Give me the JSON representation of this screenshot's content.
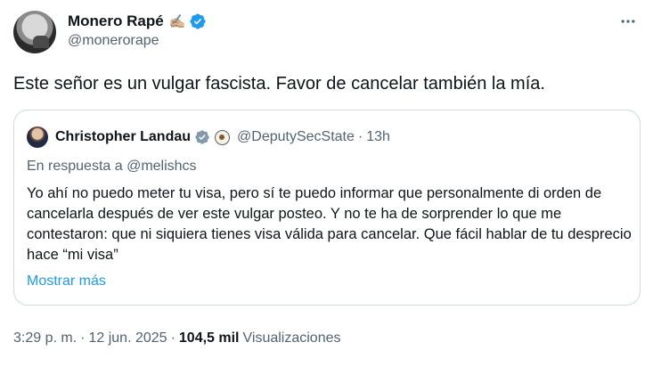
{
  "author": {
    "display_name": "Monero Rapé",
    "pen_emoji": "✍🏼",
    "handle": "@monerorape",
    "verified_color": "#1d9bf0"
  },
  "tweet": {
    "text": "Este señor es un vulgar fascista. Favor de cancelar también la mía."
  },
  "quote": {
    "display_name": "Christopher Landau",
    "handle": "@DeputySecState",
    "dot": "·",
    "time": "13h",
    "reply_to": "En respuesta a @melishcs",
    "text": "Yo ahí no puedo meter tu visa, pero sí te puedo informar que personalmente di orden de cancelarla después de ver este vulgar posteo. Y no te ha de sorprender lo que me contestaron: que ni siquiera tienes visa válida para cancelar. Que fácil hablar de tu desprecio hace “mi visa”",
    "show_more": "Mostrar más",
    "badge_color": "#829aab"
  },
  "meta": {
    "time": "3:29 p. m.",
    "sep": "·",
    "date": "12 jun. 2025",
    "sep2": "·",
    "views_count": "104,5 mil",
    "views_label": "Visualizaciones"
  },
  "icons": {
    "more": "more-horizontal-icon",
    "verified": "verified-badge-icon",
    "government": "government-badge-icon"
  }
}
